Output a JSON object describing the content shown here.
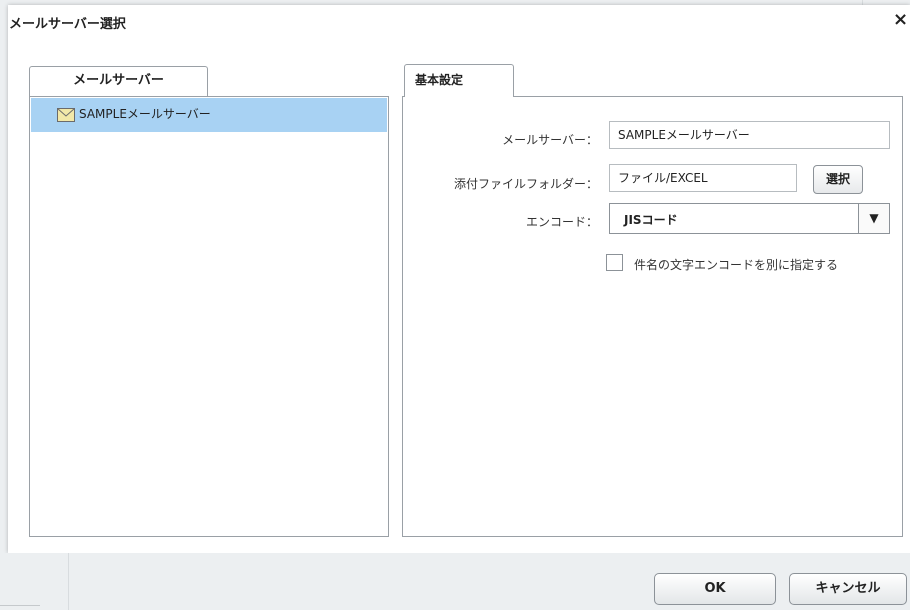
{
  "dialog": {
    "title": "メールサーバー選択",
    "close_glyph": "×"
  },
  "left": {
    "tab_label": "メールサーバー",
    "servers": [
      {
        "label": "SAMPLEメールサーバー",
        "icon": "mail-icon",
        "selected": true
      }
    ]
  },
  "right": {
    "tab_label": "基本設定",
    "mail_server_label": "メールサーバー：",
    "mail_server_value": "SAMPLEメールサーバー",
    "attach_folder_label": "添付ファイルフォルダー：",
    "attach_folder_value": "ファイル/EXCEL",
    "select_button": "選択",
    "encode_label": "エンコード：",
    "encode_value": "JISコード",
    "dropdown_arrow": "▼",
    "subject_checkbox_label": "件名の文字エンコードを別に指定する",
    "subject_checkbox_checked": false
  },
  "footer": {
    "ok_label": "OK",
    "cancel_label": "キャンセル"
  },
  "colors": {
    "selection": "#a8d2f3",
    "border": "#9aa0a6",
    "background": "#eceff1"
  }
}
